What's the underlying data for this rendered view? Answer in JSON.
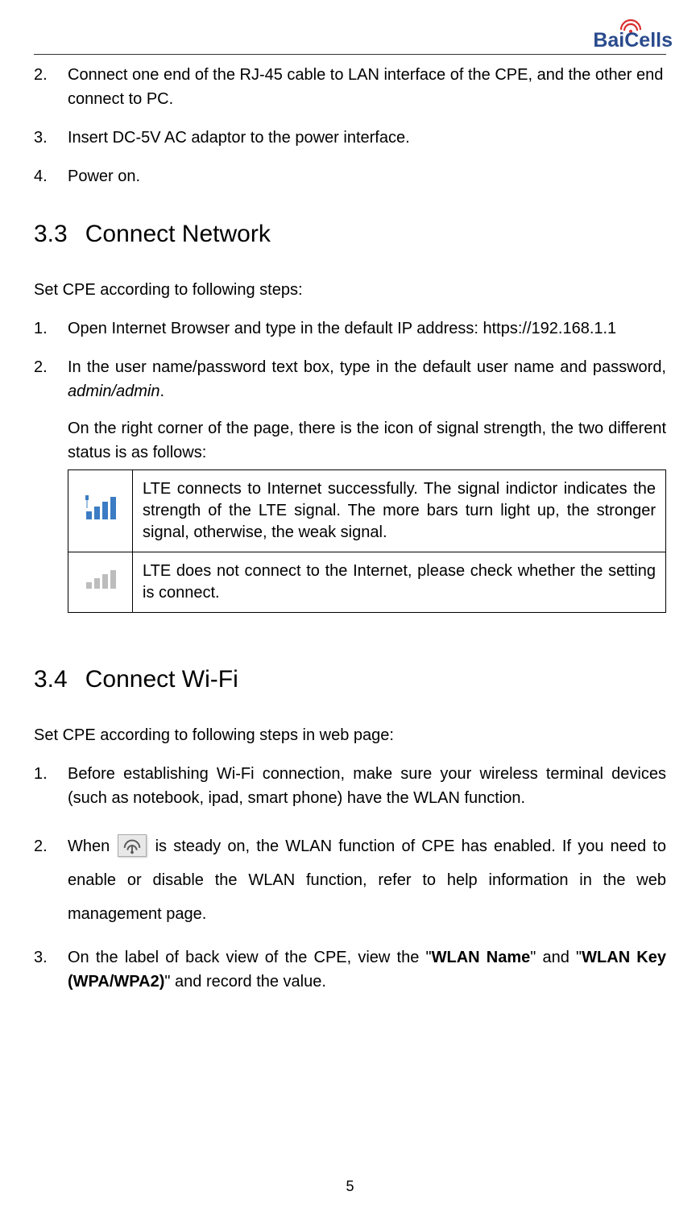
{
  "logo": {
    "brand_part1": "Bai",
    "brand_part2": "Cells"
  },
  "top_steps": {
    "s2": "Connect one end of the RJ-45 cable to LAN interface of the CPE, and the other end connect to PC.",
    "s3": "Insert DC-5V AC adaptor to the power interface.",
    "s4": "Power on."
  },
  "section_3_3": {
    "num": "3.3",
    "title": "Connect Network",
    "intro": "Set CPE according to following steps:",
    "step1": "Open Internet Browser and type in the default IP address: https://192.168.1.1",
    "step2_a": "In the user name/password text box, type in the default user name and password, ",
    "step2_b": "admin/admin",
    "step2_c": ".",
    "step2_inner": "On the right corner of the page, there is the icon of signal strength, the two different status is as follows:",
    "table": {
      "row1": "LTE connects to Internet successfully. The signal indictor indicates the strength of the LTE signal. The more bars turn light up, the stronger signal, otherwise, the weak signal.",
      "row2": "LTE does not connect to the Internet, please check whether the setting is connect."
    }
  },
  "section_3_4": {
    "num": "3.4",
    "title": "Connect Wi-Fi",
    "intro": "Set CPE according to following steps in web page:",
    "step1": "Before establishing Wi-Fi connection, make sure your wireless terminal devices (such as notebook, ipad, smart phone) have the WLAN function.",
    "step2_a": "When ",
    "step2_b": " is steady on, the WLAN function of CPE has enabled. If you need to enable or disable the WLAN function, refer to help information in the web management page.",
    "step3_a": "On the label of back view of the CPE, view the \"",
    "step3_b": "WLAN Name",
    "step3_c": "\" and \"",
    "step3_d": "WLAN Key (WPA/WPA2)",
    "step3_e": "\" and record the value."
  },
  "page_number": "5"
}
